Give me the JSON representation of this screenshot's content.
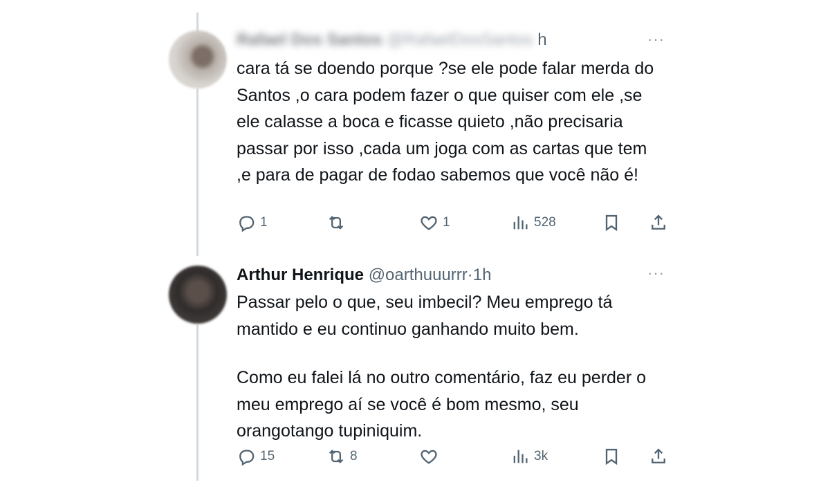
{
  "tweets": [
    {
      "author_name": "Rafael Dos Santos",
      "handle": "@RafaelDosSantos",
      "time": "h",
      "text_lines": [
        "cara tá se doendo porque ?se ele pode falar merda do Santos ,o cara podem fazer o que quiser com ele ,se ele calasse a boca e ficasse quieto ,não precisaria passar por isso ,cada um joga com as cartas que tem ,e para de pagar de fodao sabemos que você não é!"
      ],
      "replies": "1",
      "retweets": "",
      "likes": "1",
      "views": "528"
    },
    {
      "author_name": "Arthur Henrique",
      "handle": "@oarthuuurrr",
      "separator": "·",
      "time": "1h",
      "text_lines": [
        "Passar pelo o que, seu imbecil? Meu emprego tá mantido e eu continuo ganhando muito bem.",
        "Como eu falei lá no outro comentário, faz eu perder o meu emprego aí se você é bom mesmo, seu orangotango tupiniquim."
      ],
      "replies": "15",
      "retweets": "8",
      "likes": "",
      "views": "3k"
    }
  ],
  "icons": {
    "more": "more-icon",
    "reply": "reply-icon",
    "retweet": "retweet-icon",
    "like": "like-icon",
    "views": "views-icon",
    "bookmark": "bookmark-icon",
    "share": "share-icon"
  },
  "colors": {
    "text": "#0f1419",
    "secondary": "#536471",
    "thread_line": "#cfd9de"
  }
}
